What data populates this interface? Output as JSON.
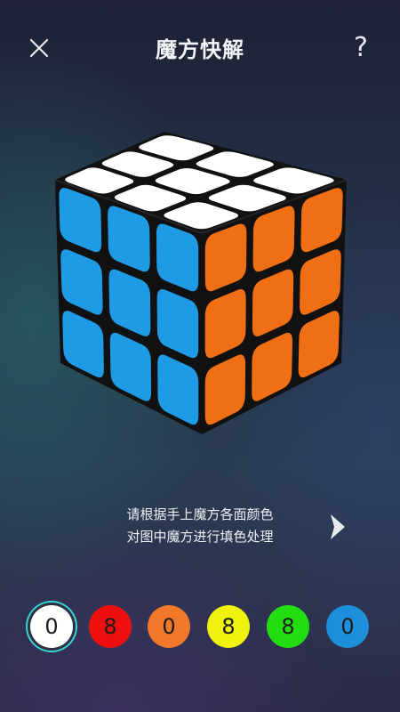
{
  "header": {
    "title": "魔方快解",
    "help_label": "?"
  },
  "instructions": {
    "line1": "请根据手上魔方各面颜色",
    "line2": "对图中魔方进行填色处理"
  },
  "cube": {
    "top_color": "#ffffff",
    "left_color": "#1f9be6",
    "right_color": "#f06e14",
    "body_color": "#111111"
  },
  "palette": [
    {
      "name": "white",
      "color": "#ffffff",
      "count": "0",
      "selected": true
    },
    {
      "name": "red",
      "color": "#ee1010",
      "count": "8",
      "selected": false
    },
    {
      "name": "orange",
      "color": "#f2782a",
      "count": "0",
      "selected": false
    },
    {
      "name": "yellow",
      "color": "#eef20c",
      "count": "8",
      "selected": false
    },
    {
      "name": "green",
      "color": "#22dd10",
      "count": "8",
      "selected": false
    },
    {
      "name": "blue",
      "color": "#1e90db",
      "count": "0",
      "selected": false
    }
  ]
}
